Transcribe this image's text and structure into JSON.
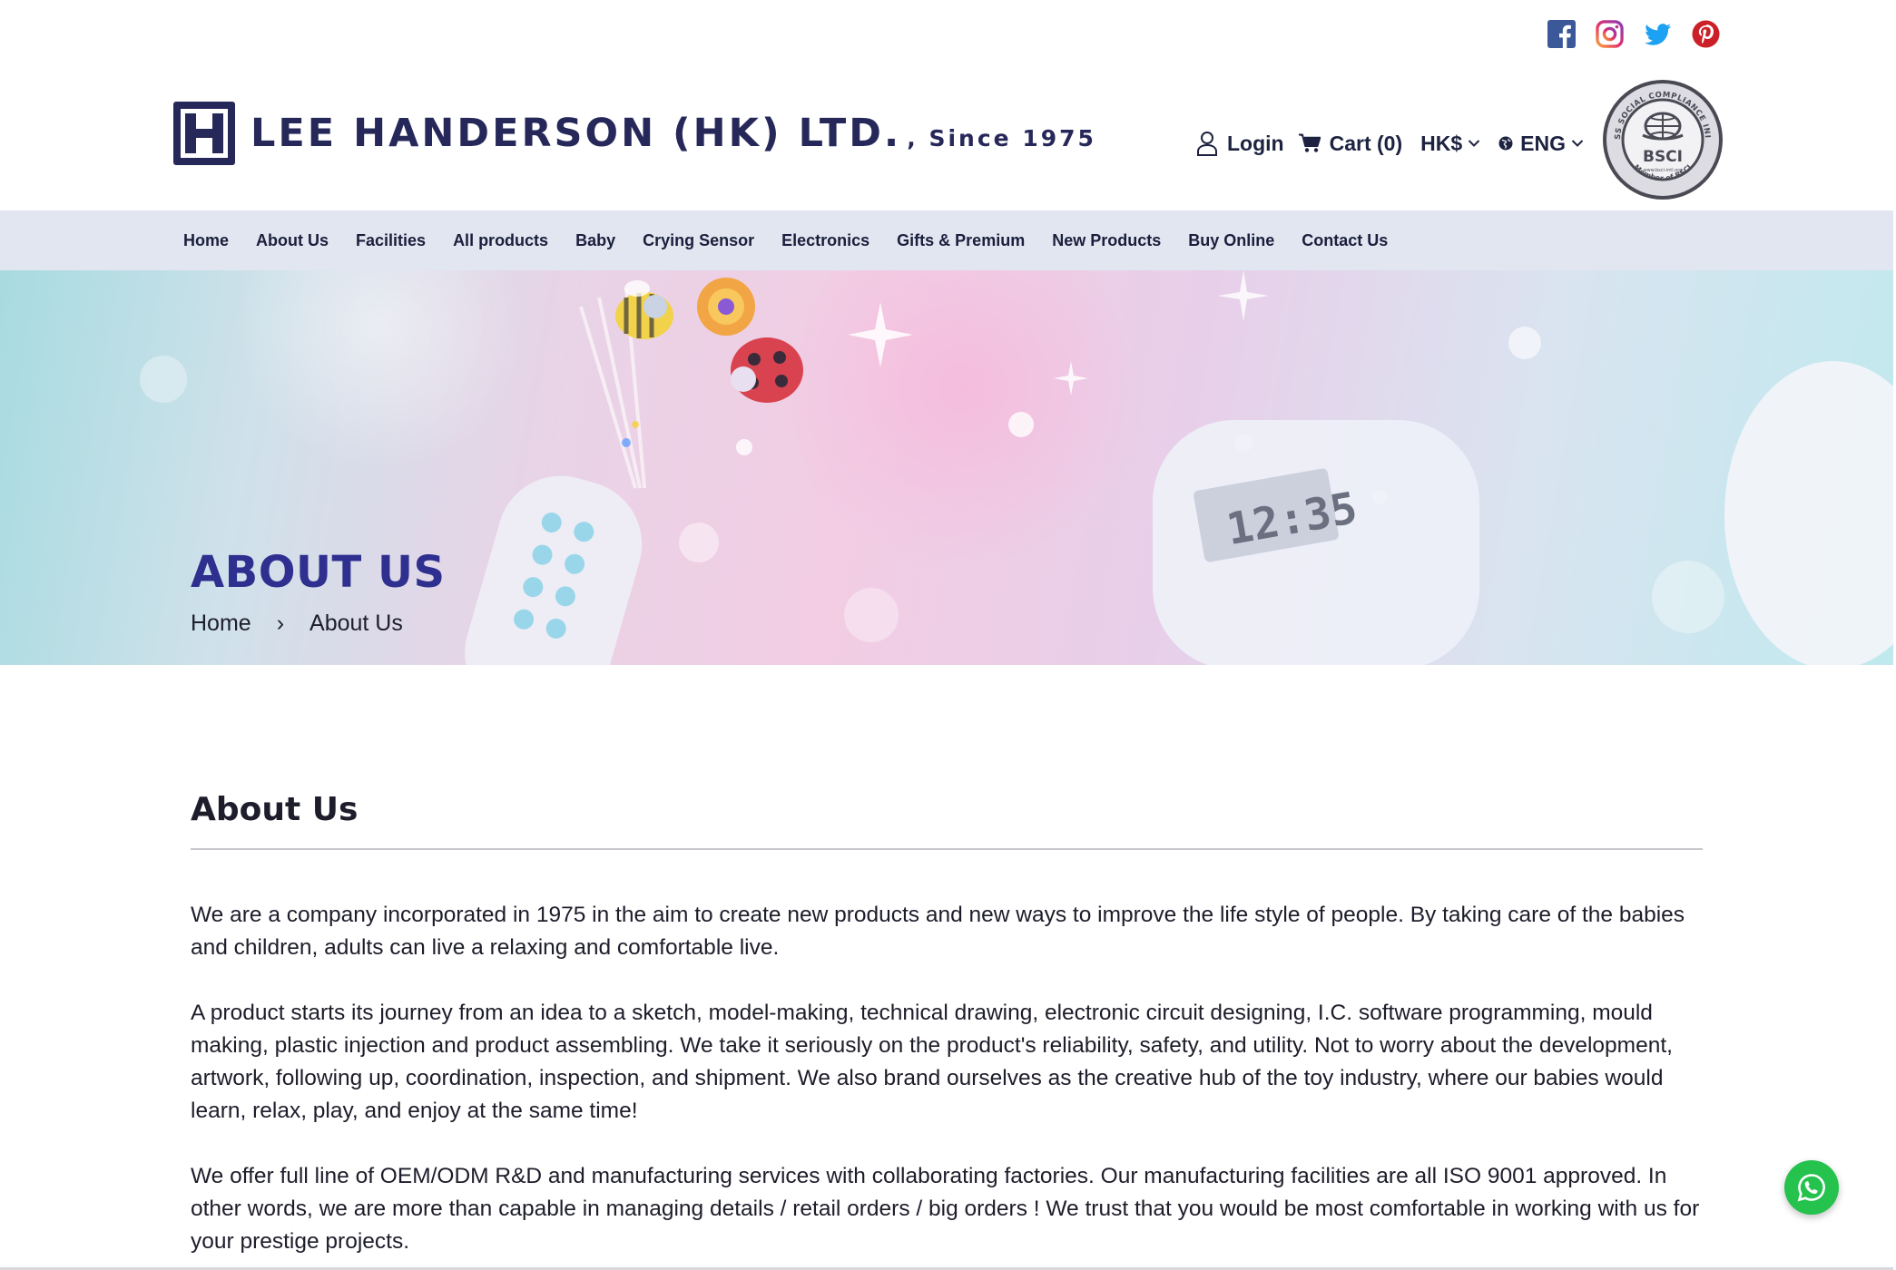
{
  "social": {
    "facebook": "facebook-icon",
    "instagram": "instagram-icon",
    "twitter": "twitter-icon",
    "pinterest": "pinterest-icon"
  },
  "brand": {
    "name": "LEE HANDERSON (HK) LTD.",
    "since": ", Since 1975",
    "color": "#27285a"
  },
  "header": {
    "login": "Login",
    "cart": "Cart (0)",
    "currency": "HK$",
    "language": "ENG",
    "badge": {
      "label": "BSCI",
      "ring_top": "BUSINESS SOCIAL COMPLIANCE INITIATIVE",
      "ring_bottom": "Member of BSCI",
      "url": "www.bsci-intl.org"
    }
  },
  "nav": {
    "items": [
      {
        "label": "Home"
      },
      {
        "label": "About Us"
      },
      {
        "label": "Facilities"
      },
      {
        "label": "All products"
      },
      {
        "label": "Baby"
      },
      {
        "label": "Crying Sensor"
      },
      {
        "label": "Electronics"
      },
      {
        "label": "Gifts & Premium"
      },
      {
        "label": "New Products"
      },
      {
        "label": "Buy Online"
      },
      {
        "label": "Contact Us"
      }
    ],
    "background": "#e1e6f0"
  },
  "hero": {
    "title": "ABOUT US",
    "title_color": "#2e2f8f",
    "breadcrumb": {
      "home": "Home",
      "separator": "›",
      "current": "About Us"
    },
    "clock_display": "12:35"
  },
  "main": {
    "heading": "About Us",
    "paragraphs": [
      "We are a company incorporated in 1975 in the aim to create new products and new ways to improve the life style of people. By taking care of the babies and children, adults can live a relaxing and comfortable live.",
      "A product starts its journey from an idea to a sketch, model-making, technical drawing, electronic circuit designing, I.C. software programming, mould making, plastic injection and product assembling.  We take it seriously on the product's reliability, safety, and utility.  Not to worry about the development, artwork, following up, coordination, inspection, and shipment.  We also brand ourselves as the creative hub of the toy industry, where our babies would learn, relax, play, and enjoy at the same time!",
      "We offer full line of OEM/ODM R&D and manufacturing services with collaborating factories. Our manufacturing facilities are all ISO 9001 approved. In other words, we are more than capable in managing details / retail orders / big orders !   We trust that you would be most comfortable in working with us for your prestige projects."
    ]
  },
  "floating": {
    "whatsapp_icon": "whatsapp-icon",
    "whatsapp_color": "#25c24d"
  }
}
